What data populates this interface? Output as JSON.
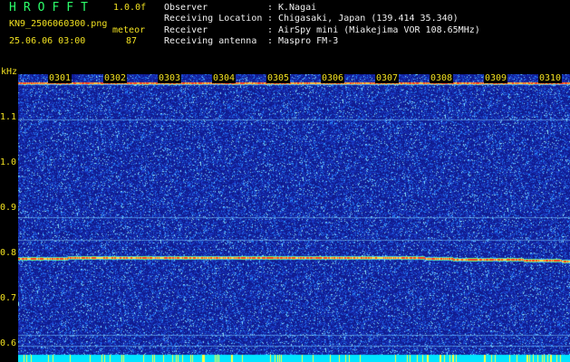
{
  "header": {
    "app_title": "HROFFT",
    "app_version": "1.0.0f",
    "file_name": "KN9_2506060300.png",
    "datetime": "25.06.06 03:00",
    "meteor_label": "meteor",
    "meteor_count": "87"
  },
  "info": [
    {
      "label": "Observer",
      "sep": ":",
      "value": "K.Nagai"
    },
    {
      "label": "Receiving Location",
      "sep": ":",
      "value": "Chigasaki, Japan (139.414 35.340)"
    },
    {
      "label": "Receiver",
      "sep": ":",
      "value": "AirSpy mini (Miakejima VOR 108.65MHz)"
    },
    {
      "label": "Receiving antenna",
      "sep": ":",
      "value": "Maspro FM-3"
    }
  ],
  "spectrogram": {
    "y_unit": "kHz",
    "y_ticks": [
      "1.1",
      "1.0",
      "0.9",
      "0.8",
      "0.7",
      "0.6"
    ],
    "hour_labels": [
      "0301",
      "0302",
      "0303",
      "0304",
      "0305",
      "0306",
      "0307",
      "0308",
      "0309",
      "0310"
    ],
    "colors": {
      "background": "#101a8c",
      "noise": "#2a7dff",
      "carrier": "#ff4020",
      "baseline": "#00e5ff",
      "label": "#f0e020"
    }
  }
}
